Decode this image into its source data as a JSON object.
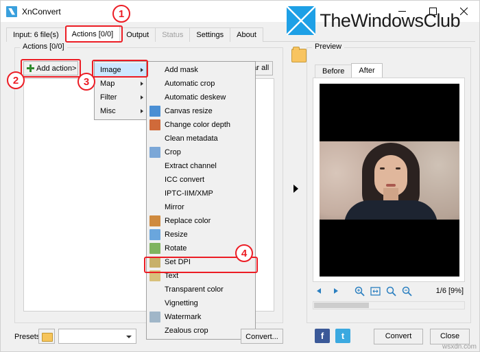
{
  "window": {
    "title": "XnConvert",
    "icon": "xnconvert-logo-icon",
    "minimize": "minimize-icon",
    "maximize": "maximize-icon",
    "close": "close-icon"
  },
  "brand": {
    "text": "TheWindowsClub",
    "mark": "windows-logo-icon"
  },
  "tabs": [
    {
      "label": "Input: 6 file(s)",
      "active": false,
      "disabled": false
    },
    {
      "label": "Actions [0/0]",
      "active": true,
      "disabled": false
    },
    {
      "label": "Output",
      "active": false,
      "disabled": false
    },
    {
      "label": "Status",
      "active": false,
      "disabled": true
    },
    {
      "label": "Settings",
      "active": false,
      "disabled": false
    },
    {
      "label": "About",
      "active": false,
      "disabled": false
    }
  ],
  "actions_panel": {
    "group_title": "Actions [0/0]",
    "add_action_label": "Add action>",
    "clear_all_label": "Clear all"
  },
  "menu_level1": [
    {
      "label": "Image",
      "selected": true
    },
    {
      "label": "Map",
      "selected": false
    },
    {
      "label": "Filter",
      "selected": false
    },
    {
      "label": "Misc",
      "selected": false
    }
  ],
  "menu_level2": [
    {
      "label": "Add mask",
      "icon": "",
      "color": ""
    },
    {
      "label": "Automatic crop",
      "icon": "",
      "color": ""
    },
    {
      "label": "Automatic deskew",
      "icon": "",
      "color": ""
    },
    {
      "label": "Canvas resize",
      "icon": "canvas-resize-icon",
      "color": "#4a8fd4"
    },
    {
      "label": "Change color depth",
      "icon": "color-depth-icon",
      "color": "#d06a3a"
    },
    {
      "label": "Clean metadata",
      "icon": "",
      "color": ""
    },
    {
      "label": "Crop",
      "icon": "crop-icon",
      "color": "#7ba7d7"
    },
    {
      "label": "Extract channel",
      "icon": "",
      "color": ""
    },
    {
      "label": "ICC convert",
      "icon": "",
      "color": ""
    },
    {
      "label": "IPTC-IIM/XMP",
      "icon": "",
      "color": ""
    },
    {
      "label": "Mirror",
      "icon": "",
      "color": ""
    },
    {
      "label": "Replace color",
      "icon": "replace-color-icon",
      "color": "#cf8a3e"
    },
    {
      "label": "Resize",
      "icon": "resize-icon",
      "color": "#6aa6dd"
    },
    {
      "label": "Rotate",
      "icon": "rotate-icon",
      "color": "#7fb45e"
    },
    {
      "label": "Set DPI",
      "icon": "set-dpi-icon",
      "color": "#c8b06a"
    },
    {
      "label": "Text",
      "icon": "text-icon",
      "color": "#d8c07a"
    },
    {
      "label": "Transparent color",
      "icon": "",
      "color": ""
    },
    {
      "label": "Vignetting",
      "icon": "",
      "color": ""
    },
    {
      "label": "Watermark",
      "icon": "watermark-icon",
      "color": "#a0b6c8"
    },
    {
      "label": "Zealous crop",
      "icon": "",
      "color": ""
    }
  ],
  "preview": {
    "group_title": "Preview",
    "tabs": [
      {
        "label": "Before",
        "active": false
      },
      {
        "label": "After",
        "active": true
      }
    ],
    "zoom_label": "1/6 [9%]",
    "toolbar_icons": [
      "previous-arrow-icon",
      "next-arrow-icon",
      "zoom-in-icon",
      "fit-to-window-icon",
      "zoom-100-icon",
      "zoom-out-icon"
    ]
  },
  "bottom": {
    "presets_label": "Presets:",
    "preset_folder_icon": "folder-icon",
    "preset_value": "",
    "convert_ghost_label": "Convert...",
    "facebook_label": "f",
    "twitter_label": "t",
    "convert_label": "Convert",
    "close_label": "Close"
  },
  "watermark": "wsxdn.com",
  "annotations": [
    {
      "number": "1"
    },
    {
      "number": "2"
    },
    {
      "number": "3"
    },
    {
      "number": "4"
    }
  ],
  "colors": {
    "accent_red": "#ec1c24",
    "brand_blue": "#1ea0e6",
    "selection_blue": "#cde8ff"
  }
}
